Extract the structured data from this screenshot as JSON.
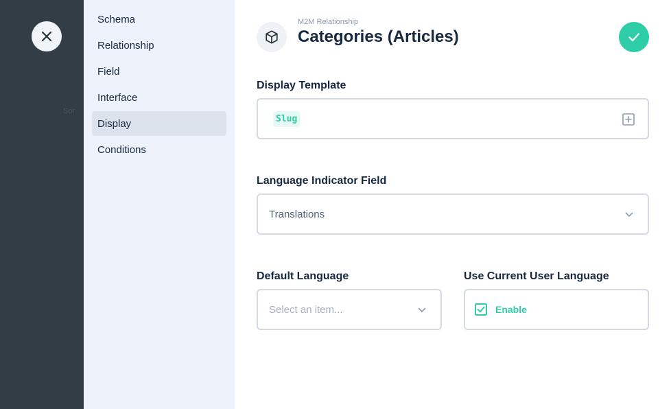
{
  "backdrop": {
    "ghost_text": "Sor"
  },
  "close_button": {
    "icon": "close-icon"
  },
  "sidebar": {
    "items": [
      {
        "label": "Schema"
      },
      {
        "label": "Relationship"
      },
      {
        "label": "Field"
      },
      {
        "label": "Interface"
      },
      {
        "label": "Display",
        "active": true
      },
      {
        "label": "Conditions"
      }
    ]
  },
  "header": {
    "icon": "box-icon",
    "subtitle": "M2M Relationship",
    "title": "Categories (Articles)",
    "save_icon": "check-icon"
  },
  "fields": {
    "display_template": {
      "label": "Display Template",
      "tag": "Slug",
      "icon": "add-field-icon"
    },
    "language_indicator": {
      "label": "Language Indicator Field",
      "value": "Translations"
    },
    "default_language": {
      "label": "Default Language",
      "placeholder": "Select an item..."
    },
    "use_current_user_language": {
      "label": "Use Current User Language",
      "checkbox_label": "Enable",
      "checked": true
    }
  },
  "colors": {
    "accent": "#2ecda7",
    "sidebar_bg": "#eef3fb",
    "backdrop": "#333d45",
    "text": "#172940"
  }
}
